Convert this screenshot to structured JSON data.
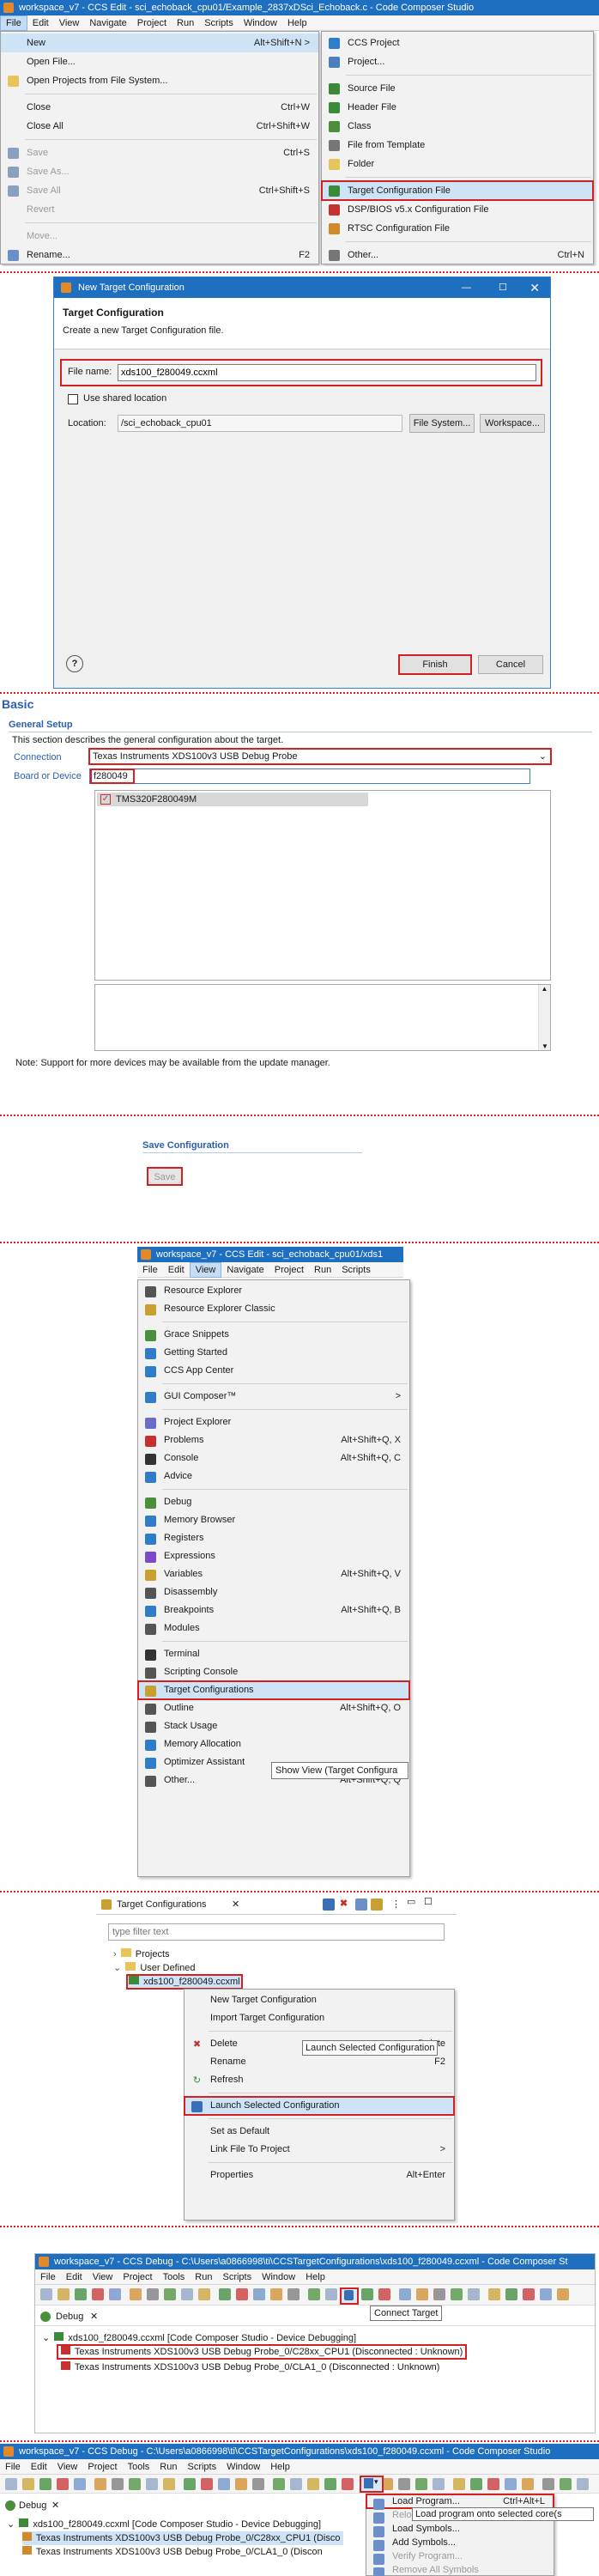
{
  "s1": {
    "title": "workspace_v7 - CCS Edit - sci_echoback_cpu01/Example_2837xDSci_Echoback.c - Code Composer Studio",
    "menubar": [
      "File",
      "Edit",
      "View",
      "Navigate",
      "Project",
      "Run",
      "Scripts",
      "Window",
      "Help"
    ],
    "file_menu": [
      {
        "label": "New",
        "key": "Alt+Shift+N >",
        "ico": ""
      },
      {
        "label": "Open File...",
        "key": "",
        "ico": ""
      },
      {
        "label": "Open Projects from File System...",
        "key": "",
        "ico": "folder"
      },
      {
        "label": "Close",
        "key": "Ctrl+W",
        "ico": ""
      },
      {
        "label": "Close All",
        "key": "Ctrl+Shift+W",
        "ico": ""
      },
      {
        "label": "Save",
        "key": "Ctrl+S",
        "ico": "save"
      },
      {
        "label": "Save As...",
        "key": "",
        "ico": "save"
      },
      {
        "label": "Save All",
        "key": "Ctrl+Shift+S",
        "ico": "save"
      },
      {
        "label": "Revert",
        "key": "",
        "ico": ""
      },
      {
        "label": "Move...",
        "key": "",
        "ico": ""
      },
      {
        "label": "Rename...",
        "key": "F2",
        "ico": "rename"
      }
    ],
    "new_menu": [
      {
        "label": "CCS Project",
        "key": ""
      },
      {
        "label": "Project...",
        "key": ""
      },
      {
        "label": "Source File",
        "key": ""
      },
      {
        "label": "Header File",
        "key": ""
      },
      {
        "label": "Class",
        "key": ""
      },
      {
        "label": "File from Template",
        "key": ""
      },
      {
        "label": "Folder",
        "key": ""
      },
      {
        "label": "Target Configuration File",
        "key": ""
      },
      {
        "label": "DSP/BIOS v5.x Configuration File",
        "key": ""
      },
      {
        "label": "RTSC Configuration File",
        "key": ""
      },
      {
        "label": "Other...",
        "key": "Ctrl+N"
      }
    ]
  },
  "s2": {
    "title": "New Target Configuration",
    "heading": "Target Configuration",
    "sub": "Create a new Target Configuration file.",
    "file_label": "File name:",
    "file_value": "xds100_f280049.ccxml",
    "shared_label": "Use shared location",
    "loc_label": "Location:",
    "loc_value": "/sci_echoback_cpu01",
    "fs_btn": "File System...",
    "ws_btn": "Workspace...",
    "help": "?",
    "finish": "Finish",
    "cancel": "Cancel"
  },
  "s3": {
    "title": "Basic",
    "gs": "General Setup",
    "desc": "This section describes the general configuration about the target.",
    "conn_label": "Connection",
    "conn_value": "Texas Instruments XDS100v3 USB Debug Probe",
    "bd_label": "Board or Device",
    "bd_value": "f280049",
    "device": "TMS320F280049M",
    "note": "Note: Support for more devices may be available from the update manager."
  },
  "s4": {
    "title": "Save Configuration",
    "save": "Save"
  },
  "s5": {
    "title": "workspace_v7 - CCS Edit - sci_echoback_cpu01/xds1",
    "menubar": [
      "File",
      "Edit",
      "View",
      "Navigate",
      "Project",
      "Run",
      "Scripts"
    ],
    "items": [
      {
        "label": "Resource Explorer",
        "key": "",
        "c": "#555"
      },
      {
        "label": "Resource Explorer Classic",
        "key": "",
        "c": "#c8a030"
      },
      "-",
      {
        "label": "Grace Snippets",
        "key": "",
        "c": "#4a8f3a"
      },
      {
        "label": "Getting Started",
        "key": "",
        "c": "#2f7dc8"
      },
      {
        "label": "CCS App Center",
        "key": "",
        "c": "#2f7dc8"
      },
      "-",
      {
        "label": "GUI Composer™",
        "key": ">",
        "c": "#2f7dc8"
      },
      "-",
      {
        "label": "Project Explorer",
        "key": "",
        "c": "#6b6bc8"
      },
      {
        "label": "Problems",
        "key": "Alt+Shift+Q, X",
        "c": "#c83030"
      },
      {
        "label": "Console",
        "key": "Alt+Shift+Q, C",
        "c": "#333"
      },
      {
        "label": "Advice",
        "key": "",
        "c": "#2f7dc8"
      },
      "-",
      {
        "label": "Debug",
        "key": "",
        "c": "#4a8f3a"
      },
      {
        "label": "Memory Browser",
        "key": "",
        "c": "#2f7dc8"
      },
      {
        "label": "Registers",
        "key": "",
        "c": "#2f7dc8"
      },
      {
        "label": "Expressions",
        "key": "",
        "c": "#7a4ac8"
      },
      {
        "label": "Variables",
        "key": "Alt+Shift+Q, V",
        "c": "#c8a030"
      },
      {
        "label": "Disassembly",
        "key": "",
        "c": "#555"
      },
      {
        "label": "Breakpoints",
        "key": "Alt+Shift+Q, B",
        "c": "#2f7dc8"
      },
      {
        "label": "Modules",
        "key": "",
        "c": "#555"
      },
      "-",
      {
        "label": "Terminal",
        "key": "",
        "c": "#333"
      },
      {
        "label": "Scripting Console",
        "key": "",
        "c": "#555"
      },
      {
        "label": "Target Configurations",
        "key": "",
        "c": "#c8a030"
      },
      {
        "label": "Outline",
        "key": "Alt+Shift+Q, O",
        "c": "#555"
      },
      {
        "label": "Stack Usage",
        "key": "",
        "c": "#555"
      },
      {
        "label": "Memory Allocation",
        "key": "",
        "c": "#2f7dc8"
      },
      {
        "label": "Optimizer Assistant",
        "key": "",
        "c": "#2f7dc8"
      },
      {
        "label": "Other...",
        "key": "Alt+Shift+Q, Q",
        "c": "#555"
      }
    ],
    "tooltip": "Show View (Target Configura"
  },
  "s6": {
    "tab": "Target Configurations",
    "filter": "type filter text",
    "projects": "Projects",
    "user_defined": "User Defined",
    "file": "xds100_f280049.ccxml",
    "menu": [
      {
        "label": "New Target Configuration",
        "key": ""
      },
      {
        "label": "Import Target Configuration",
        "key": ""
      },
      "-",
      {
        "label": "Delete",
        "key": "Delete"
      },
      {
        "label": "Rename",
        "key": "F2"
      },
      {
        "label": "Refresh",
        "key": ""
      },
      "-",
      {
        "label": "Launch Selected Configuration",
        "key": ""
      },
      "-",
      {
        "label": "Set as Default",
        "key": ""
      },
      {
        "label": "Link File To Project",
        "key": ">"
      },
      "-",
      {
        "label": "Properties",
        "key": "Alt+Enter"
      }
    ],
    "tooltip": "Launch Selected Configuration"
  },
  "s7": {
    "title": "workspace_v7 - CCS Debug - C:\\Users\\a0866998\\ti\\CCSTargetConfigurations\\xds100_f280049.ccxml - Code Composer St",
    "menubar": [
      "File",
      "Edit",
      "View",
      "Project",
      "Tools",
      "Run",
      "Scripts",
      "Window",
      "Help"
    ],
    "tooltip": "Connect Target",
    "tab": "Debug",
    "row1": "xds100_f280049.ccxml [Code Composer Studio - Device Debugging]",
    "row2": "Texas Instruments XDS100v3 USB Debug Probe_0/C28xx_CPU1 (Disconnected : Unknown)",
    "row3": "Texas Instruments XDS100v3 USB Debug Probe_0/CLA1_0 (Disconnected : Unknown)"
  },
  "s8": {
    "title": "workspace_v7 - CCS Debug - C:\\Users\\a0866998\\ti\\CCSTargetConfigurations\\xds100_f280049.ccxml - Code Composer Studio",
    "menubar": [
      "File",
      "Edit",
      "View",
      "Project",
      "Tools",
      "Run",
      "Scripts",
      "Window",
      "Help"
    ],
    "tab": "Debug",
    "row1": "xds100_f280049.ccxml [Code Composer Studio - Device Debugging]",
    "row2": "Texas Instruments XDS100v3 USB Debug Probe_0/C28xx_CPU1 (Disco",
    "row3": "Texas Instruments XDS100v3 USB Debug Probe_0/CLA1_0 (Discon",
    "menu": [
      {
        "label": "Load Program...",
        "key": "Ctrl+Alt+L"
      },
      {
        "label": "Reload Program",
        "key": ""
      },
      {
        "label": "Load Symbols...",
        "key": ""
      },
      {
        "label": "Add Symbols...",
        "key": ""
      },
      {
        "label": "Verify Program...",
        "key": ""
      },
      {
        "label": "Remove All Symbols",
        "key": ""
      }
    ],
    "tooltip": "Load program onto selected core(s"
  }
}
